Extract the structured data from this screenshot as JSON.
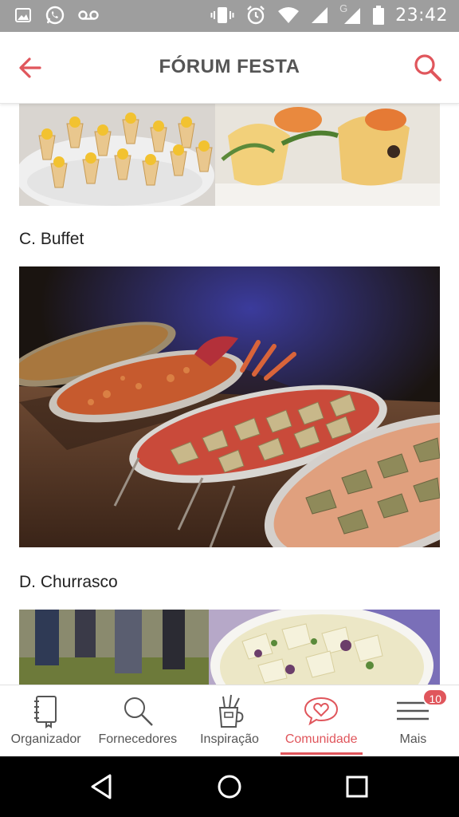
{
  "status_bar": {
    "time": "23:42",
    "icons": [
      "image-icon",
      "whatsapp-icon",
      "voicemail-icon",
      "vibrate-icon",
      "alarm-icon",
      "wifi-icon",
      "signal-icon",
      "g-signal-icon",
      "battery-icon"
    ],
    "g_label": "G"
  },
  "app_bar": {
    "title": "FÓRUM FESTA",
    "back_icon": "arrow-left-icon",
    "search_icon": "search-icon"
  },
  "content": {
    "sections": [
      {
        "label": "C. Buffet"
      },
      {
        "label": "D. Churrasco"
      }
    ]
  },
  "bottom_nav": {
    "items": [
      {
        "label": "Organizador",
        "icon": "notebook-icon"
      },
      {
        "label": "Fornecedores",
        "icon": "magnifier-icon"
      },
      {
        "label": "Inspiração",
        "icon": "cup-brushes-icon"
      },
      {
        "label": "Comunidade",
        "icon": "heart-chat-icon",
        "active": true
      },
      {
        "label": "Mais",
        "icon": "menu-icon",
        "badge": "10"
      }
    ]
  },
  "colors": {
    "accent": "#e0565c",
    "status_bar": "#9e9e9e",
    "title_text": "#555555"
  }
}
